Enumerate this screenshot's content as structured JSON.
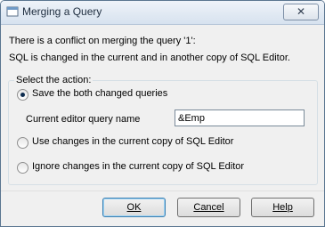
{
  "window": {
    "title": "Merging a Query"
  },
  "message": {
    "line1": "There is a conflict on merging the query '1':",
    "line2": "SQL is changed in the current and in another copy of SQL Editor."
  },
  "action_group": {
    "label": "Select the action:",
    "options": [
      {
        "label": "Save the both changed queries",
        "selected": true
      },
      {
        "label": "Use changes in the current copy of SQL Editor",
        "selected": false
      },
      {
        "label": "Ignore changes in the current copy of SQL Editor",
        "selected": false
      }
    ],
    "query_name_label": "Current editor query name",
    "query_name_value": "&Emp"
  },
  "buttons": {
    "ok": "OK",
    "cancel": "Cancel",
    "help": "Help"
  },
  "colors": {
    "accent": "#3c7fb1",
    "radio_dot": "#0d2c4f"
  },
  "icons": {
    "title": "dialog-icon",
    "close": "close-icon"
  }
}
